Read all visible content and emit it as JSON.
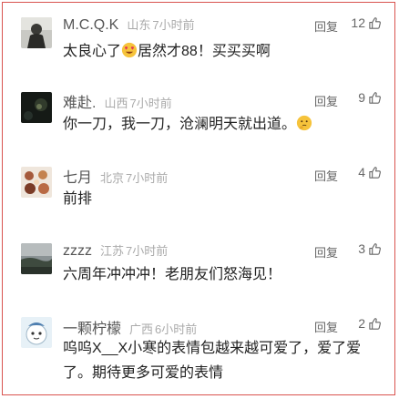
{
  "comments": [
    {
      "username": "M.C.Q.K",
      "location": "山东",
      "time": "7小时前",
      "reply_label": "回复",
      "likes": "12",
      "text": "太良心了",
      "emoji": "heart-eyes-emoji",
      "text_after": "居然才88！买买买啊"
    },
    {
      "username": "难赴.",
      "location": "山西",
      "time": "7小时前",
      "reply_label": "回复",
      "likes": "9",
      "text": "你一刀，我一刀，沧澜明天就出道。",
      "emoji": "thinking-emoji",
      "text_after": ""
    },
    {
      "username": "七月",
      "location": "北京",
      "time": "7小时前",
      "reply_label": "回复",
      "likes": "4",
      "text": "前排",
      "emoji": "",
      "text_after": ""
    },
    {
      "username": "zzzz",
      "location": "江苏",
      "time": "7小时前",
      "reply_label": "回复",
      "likes": "3",
      "text": "六周年冲冲冲！老朋友们怒海见！",
      "emoji": "",
      "text_after": ""
    },
    {
      "username": "一颗柠檬",
      "location": "广西",
      "time": "6小时前",
      "reply_label": "回复",
      "likes": "2",
      "text": "呜呜X__X小寒的表情包越来越可爱了，爱了爱了。期待更多可爱的表情",
      "emoji": "",
      "text_after": ""
    }
  ],
  "colors": {
    "username": "#555555",
    "meta": "#aaaaaa",
    "text": "#222222",
    "border": "#d9534f"
  },
  "icons": {
    "like": "thumbs-up-icon"
  }
}
